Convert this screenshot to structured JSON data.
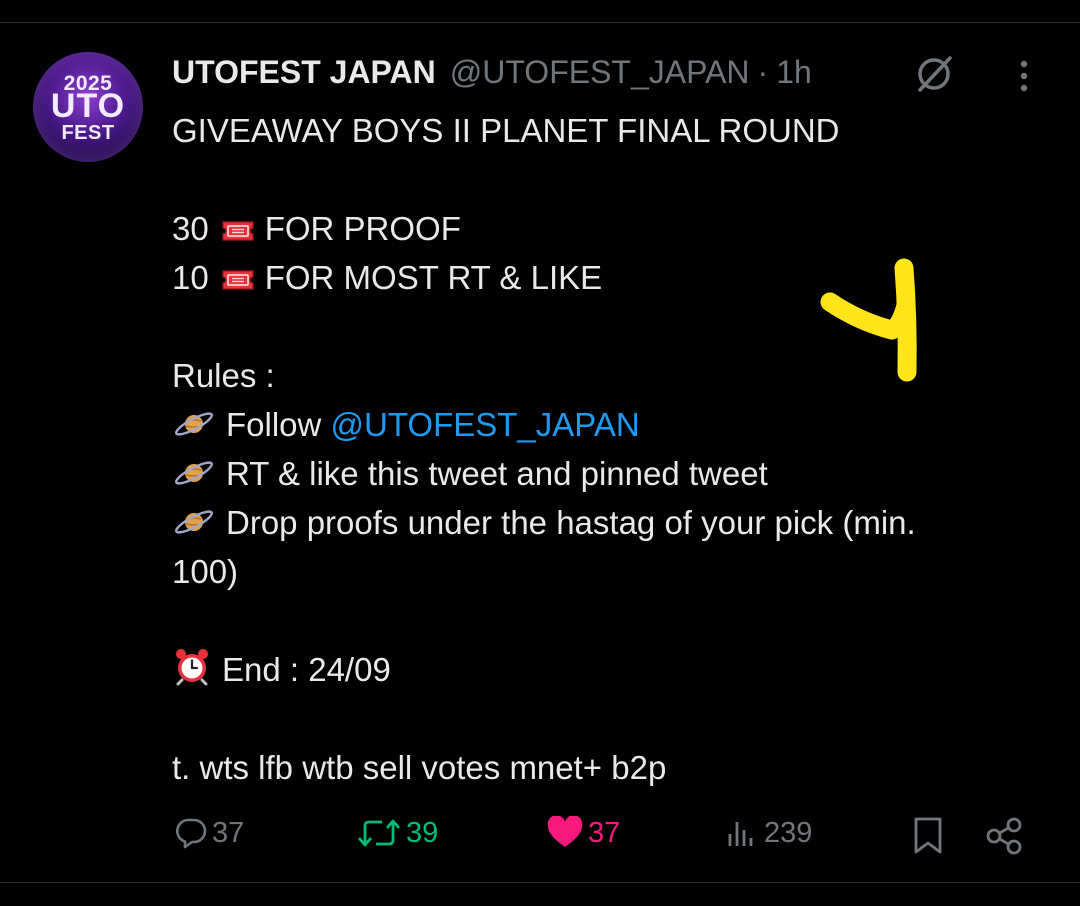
{
  "post": {
    "avatar": {
      "line1": "2025",
      "line2": "UTO",
      "line3": "FEST"
    },
    "display_name": "UTOFEST JAPAN",
    "handle": "@UTOFEST_JAPAN",
    "separator": "·",
    "time": "1h",
    "lines": {
      "title": "GIVEAWAY BOYS II PLANET FINAL ROUND",
      "prize1_count": "30",
      "prize1_text": "FOR PROOF",
      "prize2_count": "10",
      "prize2_text": "FOR MOST RT & LIKE",
      "rules_heading": "Rules :",
      "rule1_text": "Follow",
      "rule1_mention": "@UTOFEST_JAPAN",
      "rule2_text": "RT & like this tweet and pinned tweet",
      "rule3_text": "Drop proofs under the hastag of your pick (min.",
      "rule3_cont": "100)",
      "end_text": "End : 24/09",
      "tags": "t. wts lfb wtb sell votes mnet+ b2p"
    },
    "icons": {
      "ticket": "ticket-emoji",
      "planet": "ringed-planet-emoji",
      "alarm": "alarm-clock-emoji",
      "grok": "grok-icon",
      "more": "more-icon"
    },
    "doodle_color": "#ffe51a"
  },
  "actions": {
    "replies": "37",
    "reposts": "39",
    "likes": "37",
    "views": "239"
  },
  "colors": {
    "background": "#000000",
    "text": "#e7e9ea",
    "muted": "#71767b",
    "mention": "#1d9bf0",
    "repost": "#00ba7c",
    "like": "#f91880"
  }
}
